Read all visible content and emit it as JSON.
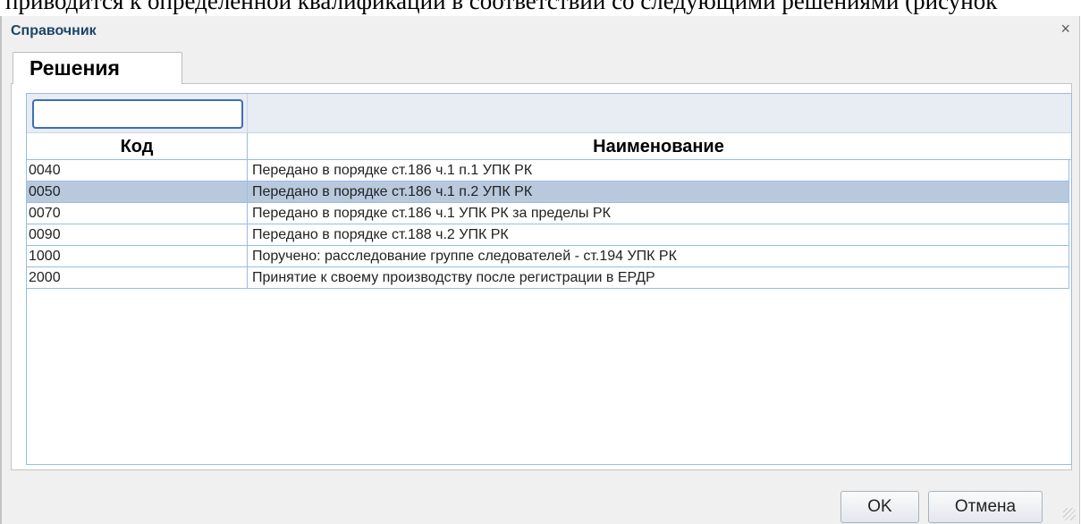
{
  "document": {
    "top_text": "приводится к определенной квалификации в соответствии со следующими решениями (рисунок"
  },
  "dialog": {
    "title": "Справочник",
    "close_glyph": "×",
    "tab_label": "Решения",
    "filter": {
      "value": "",
      "placeholder": ""
    },
    "columns": {
      "code": "Код",
      "name": "Наименование"
    },
    "rows": [
      {
        "code": "0040",
        "name": "Передано в порядке ст.186 ч.1 п.1 УПК РК",
        "selected": false
      },
      {
        "code": "0050",
        "name": "Передано в порядке ст.186 ч.1 п.2 УПК РК",
        "selected": true
      },
      {
        "code": "0070",
        "name": "Передано в порядке ст.186 ч.1 УПК РК за пределы РК",
        "selected": false
      },
      {
        "code": "0090",
        "name": "Передано в порядке ст.188 ч.2 УПК РК",
        "selected": false
      },
      {
        "code": "1000",
        "name": "Поручено: расследование группе следователей - ст.194 УПК РК",
        "selected": false
      },
      {
        "code": "2000",
        "name": "Принятие к своему производству после регистрации в ЕРДР",
        "selected": false
      }
    ],
    "buttons": {
      "ok": "OK",
      "cancel": "Отмена"
    }
  },
  "colors": {
    "title": "#1b4468",
    "grid_border": "#99bbe8",
    "selected_row": "#b9c9dd",
    "filter_focus": "#3d6fb6"
  },
  "icons": {
    "close": "close-icon",
    "resize": "resize-grip-icon"
  }
}
